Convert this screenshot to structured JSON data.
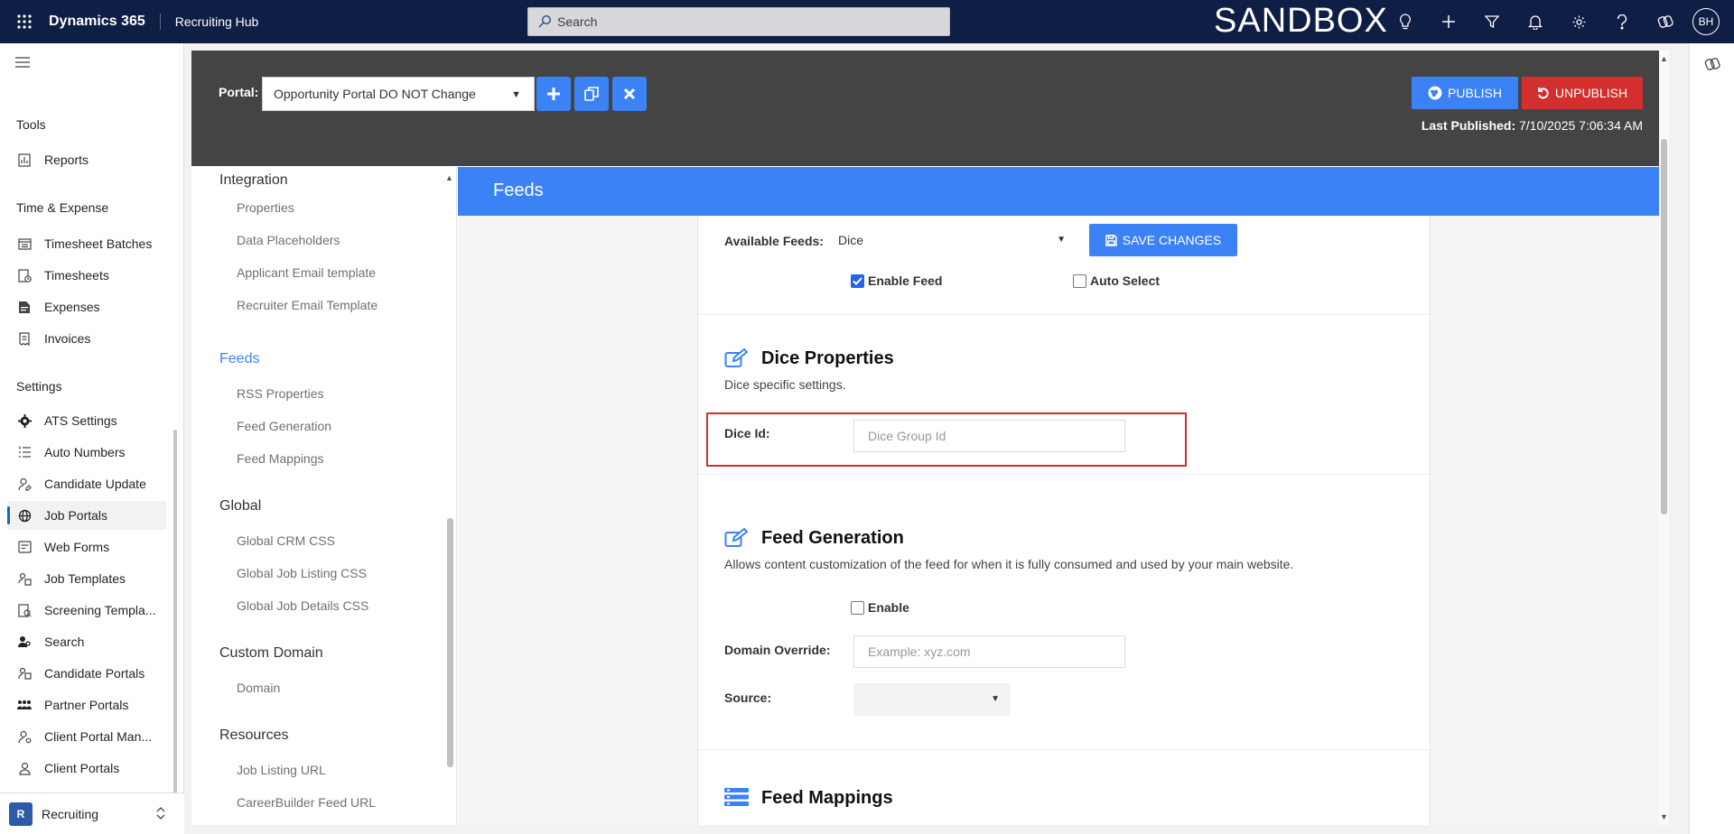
{
  "topbar": {
    "app_name": "Dynamics 365",
    "area_name": "Recruiting Hub",
    "search_placeholder": "Search",
    "environment": "SANDBOX",
    "avatar_initials": "BH"
  },
  "leftnav": {
    "groups": {
      "tools": "Tools",
      "time_expense": "Time & Expense",
      "settings": "Settings"
    },
    "items": {
      "reports": "Reports",
      "timesheet_batches": "Timesheet Batches",
      "timesheets": "Timesheets",
      "expenses": "Expenses",
      "invoices": "Invoices",
      "ats_settings": "ATS Settings",
      "auto_numbers": "Auto Numbers",
      "candidate_update": "Candidate Update",
      "job_portals": "Job Portals",
      "web_forms": "Web Forms",
      "job_templates": "Job Templates",
      "screening_templates": "Screening Templa...",
      "search": "Search",
      "candidate_portals": "Candidate Portals",
      "partner_portals": "Partner Portals",
      "client_portal_man": "Client Portal Man...",
      "client_portals": "Client Portals"
    },
    "area_switcher": {
      "badge": "R",
      "label": "Recruiting"
    }
  },
  "header": {
    "portal_label": "Portal:",
    "portal_value": "Opportunity Portal DO NOT Change",
    "publish_label": "PUBLISH",
    "unpublish_label": "UNPUBLISH",
    "last_published_label": "Last Published:",
    "last_published_value": "7/10/2025 7:06:34 AM"
  },
  "tree": {
    "integration": "Integration",
    "properties": "Properties",
    "data_placeholders": "Data Placeholders",
    "applicant_email": "Applicant Email template",
    "recruiter_email": "Recruiter Email Template",
    "feeds": "Feeds",
    "rss_properties": "RSS Properties",
    "feed_generation": "Feed Generation",
    "feed_mappings": "Feed Mappings",
    "global": "Global",
    "global_crm_css": "Global CRM CSS",
    "global_job_listing_css": "Global Job Listing CSS",
    "global_job_details_css": "Global Job Details CSS",
    "custom_domain": "Custom Domain",
    "domain": "Domain",
    "resources": "Resources",
    "job_listing_url": "Job Listing URL",
    "careerbuilder_feed_url": "CareerBuilder Feed URL"
  },
  "content": {
    "band_title": "Feeds",
    "available_feeds_label": "Available Feeds:",
    "available_feeds_value": "Dice",
    "save_changes": "SAVE CHANGES",
    "enable_feed": "Enable Feed",
    "enable_feed_checked": true,
    "auto_select": "Auto Select",
    "auto_select_checked": false,
    "dice_properties_title": "Dice Properties",
    "dice_properties_desc": "Dice specific settings.",
    "dice_id_label": "Dice Id:",
    "dice_id_placeholder": "Dice Group Id",
    "feed_generation_title": "Feed Generation",
    "feed_generation_desc": "Allows content customization of the feed for when it is fully consumed and used by your main website.",
    "enable_label": "Enable",
    "enable_checked": false,
    "domain_override_label": "Domain Override:",
    "domain_override_placeholder": "Example: xyz.com",
    "source_label": "Source:",
    "source_value": "",
    "feed_mappings_title": "Feed Mappings"
  },
  "colors": {
    "topbar": "#0f1e44",
    "accent_blue": "#3b82f6",
    "unpublish_red": "#d32f2f",
    "header_gray": "#444444"
  }
}
